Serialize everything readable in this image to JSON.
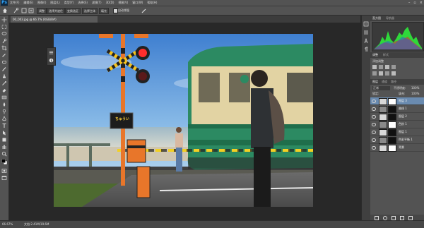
{
  "app": {
    "logo_text": "Ps"
  },
  "menu": {
    "items": [
      "文件(F)",
      "编辑(E)",
      "图像(I)",
      "图层(L)",
      "类型(Y)",
      "选择(S)",
      "滤镜(T)",
      "3D(D)",
      "视图(V)",
      "窗口(W)",
      "帮助(H)"
    ]
  },
  "window_controls": {
    "minimize": "–",
    "maximize": "▫",
    "close": "×"
  },
  "options": {
    "buttons": [
      "调整",
      "选择并遮住",
      "变换选区",
      "选择主体",
      "填充",
      "投影",
      "对齐"
    ],
    "checkbox_label": "自动增强"
  },
  "document": {
    "tab_title": "00_003.jpg @ 66.7% (RGB/8#)"
  },
  "status": {
    "zoom": "66.67%",
    "doc_info": "文档:2.41M/19.6M"
  },
  "panels": {
    "histogram_tabs": [
      "直方图",
      "导航器"
    ],
    "adjust_tabs": [
      "调整",
      "样式"
    ],
    "adjust_label": "添加调整",
    "layers_tabs": [
      "图层",
      "通道",
      "路径"
    ],
    "blend_mode": "正常",
    "opacity_label": "不透明度:",
    "opacity_value": "100%",
    "lock_label": "锁定:",
    "fill_label": "填充:",
    "fill_value": "100%",
    "layers": [
      {
        "name": "图层 3",
        "selected": true
      },
      {
        "name": "曲线 1",
        "selected": false
      },
      {
        "name": "图层 2",
        "selected": false
      },
      {
        "name": "色阶 1",
        "selected": false
      },
      {
        "name": "图层 1",
        "selected": false
      },
      {
        "name": "色彩平衡 1",
        "selected": false
      },
      {
        "name": "背景",
        "selected": false
      }
    ]
  },
  "photo": {
    "sign_text": "ちゅうい"
  },
  "colors": {
    "accent": "#6a8bb0",
    "histogram_green": "#2fd83a",
    "sky": "#4f8fd6"
  }
}
